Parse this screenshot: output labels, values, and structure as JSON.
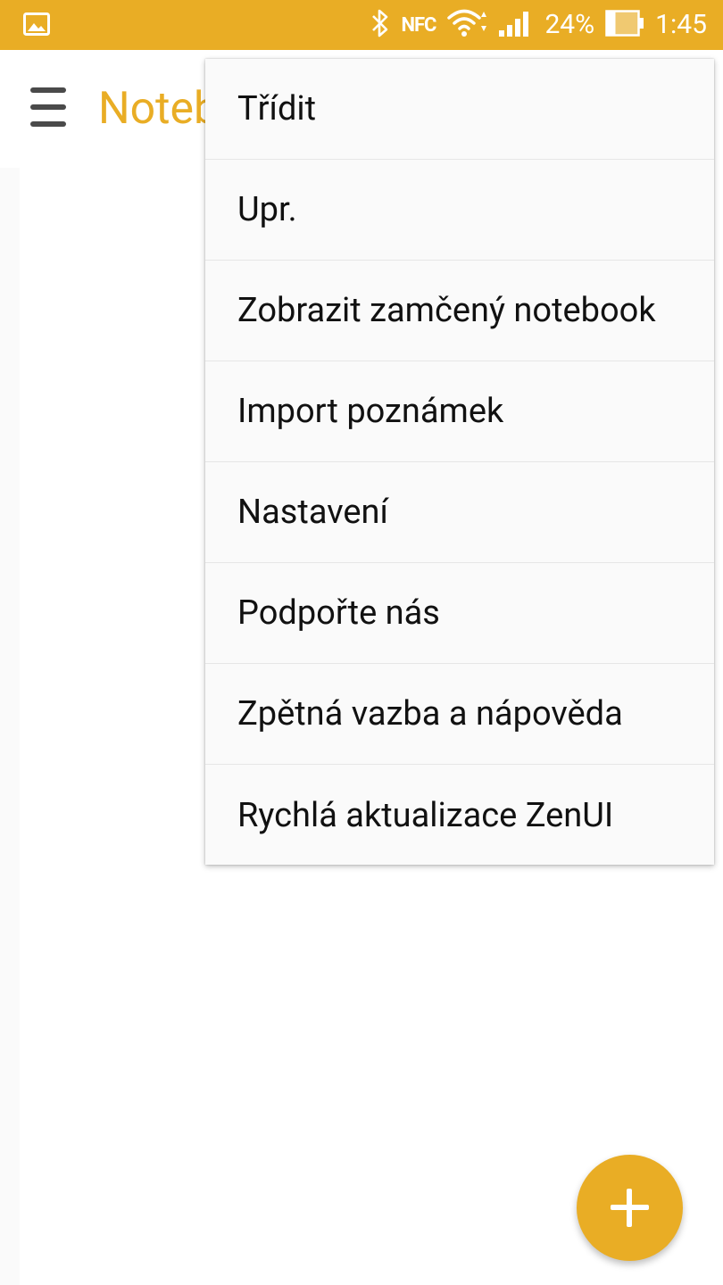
{
  "status_bar": {
    "icons": [
      "image-icon",
      "bluetooth-icon",
      "nfc-icon",
      "wifi-icon",
      "signal-icon",
      "battery-icon"
    ],
    "nfc_label": "NFC",
    "battery_percent": "24%",
    "time": "1:45"
  },
  "app_bar": {
    "title": "Noteb"
  },
  "menu": {
    "items": [
      {
        "label": "Třídit"
      },
      {
        "label": "Upr."
      },
      {
        "label": "Zobrazit zamčený notebook"
      },
      {
        "label": "Import poznámek"
      },
      {
        "label": "Nastavení"
      },
      {
        "label": "Podpořte nás"
      },
      {
        "label": "Zpětná vazba a nápověda"
      },
      {
        "label": "Rychlá aktualizace ZenUI"
      }
    ]
  },
  "colors": {
    "accent": "#E9AD25",
    "menu_background": "#FAFAFA",
    "menu_text": "#111111"
  }
}
